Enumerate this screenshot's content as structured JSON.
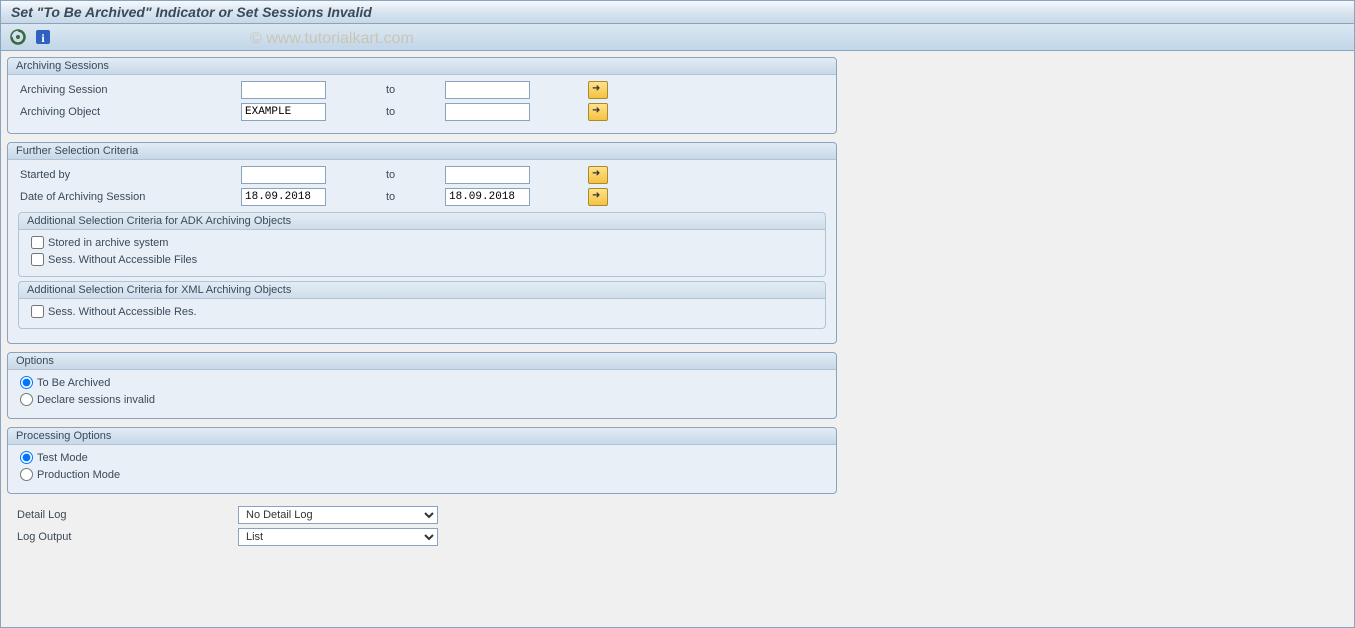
{
  "title": "Set \"To Be Archived\" Indicator or Set Sessions Invalid",
  "watermark": "© www.tutorialkart.com",
  "sections": {
    "archiving_sessions": {
      "header": "Archiving Sessions",
      "rows": {
        "session": {
          "label": "Archiving Session",
          "from": "",
          "to_label": "to",
          "to": ""
        },
        "object": {
          "label": "Archiving Object",
          "from": "EXAMPLE",
          "to_label": "to",
          "to": ""
        }
      }
    },
    "further_criteria": {
      "header": "Further Selection Criteria",
      "rows": {
        "started_by": {
          "label": "Started by",
          "from": "",
          "to_label": "to",
          "to": ""
        },
        "date": {
          "label": "Date of Archiving Session",
          "from": "18.09.2018",
          "to_label": "to",
          "to": "18.09.2018"
        }
      },
      "adk": {
        "header": "Additional Selection Criteria for ADK Archiving Objects",
        "checkboxes": {
          "stored": "Stored in archive system",
          "no_files": "Sess. Without Accessible Files"
        }
      },
      "xml": {
        "header": "Additional Selection Criteria for XML Archiving Objects",
        "checkboxes": {
          "no_res": "Sess. Without Accessible Res."
        }
      }
    },
    "options": {
      "header": "Options",
      "radios": {
        "to_be_archived": "To Be Archived",
        "declare_invalid": "Declare sessions invalid"
      }
    },
    "processing": {
      "header": "Processing Options",
      "radios": {
        "test": "Test Mode",
        "prod": "Production Mode"
      }
    }
  },
  "bottom": {
    "detail_log": {
      "label": "Detail Log",
      "value": "No Detail Log"
    },
    "log_output": {
      "label": "Log Output",
      "value": "List"
    }
  }
}
